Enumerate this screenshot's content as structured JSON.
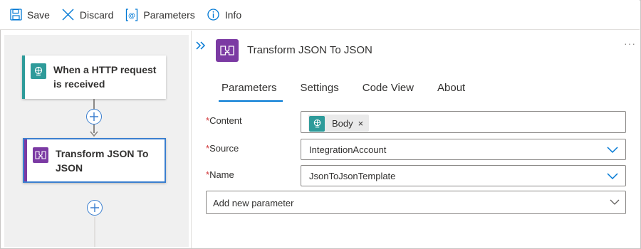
{
  "toolbar": {
    "save_label": "Save",
    "discard_label": "Discard",
    "parameters_label": "Parameters",
    "info_label": "Info"
  },
  "canvas": {
    "trigger_title": "When a HTTP request is received",
    "action_title": "Transform JSON To JSON"
  },
  "panel": {
    "title": "Transform JSON To JSON",
    "more": "···",
    "tabs": [
      {
        "label": "Parameters",
        "active": true
      },
      {
        "label": "Settings",
        "active": false
      },
      {
        "label": "Code View",
        "active": false
      },
      {
        "label": "About",
        "active": false
      }
    ],
    "fields": {
      "content": {
        "required": "*",
        "label": "Content",
        "token": "Body",
        "token_remove": "×"
      },
      "source": {
        "required": "*",
        "label": "Source",
        "value": "IntegrationAccount"
      },
      "name": {
        "required": "*",
        "label": "Name",
        "value": "JsonToJsonTemplate"
      }
    },
    "add_parameter": "Add new parameter"
  },
  "colors": {
    "accent": "#0078d4",
    "http_trigger": "#2e9b9a",
    "transform_action": "#7b3aa3",
    "required": "#d13438"
  }
}
